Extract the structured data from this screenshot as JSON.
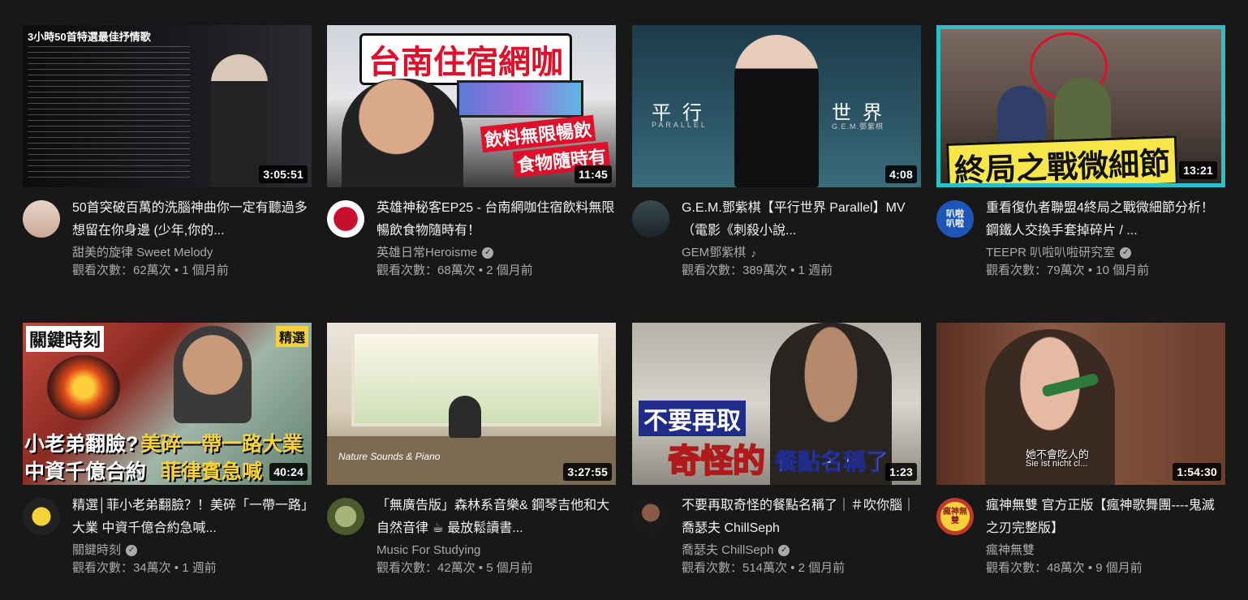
{
  "videos": [
    {
      "title": "50首突破百萬的洗腦神曲你一定有聽過多想留在你身邊 (少年,你的...",
      "channel": "甜美的旋律 Sweet Melody",
      "verified": false,
      "music_note": false,
      "views": "觀看次數：62萬次",
      "age": "1 個月前",
      "duration": "3:05:51",
      "thumb_text": "3小時50首特選最佳抒情歌"
    },
    {
      "title": "英雄神秘客EP25 - 台南網咖住宿飲料無限暢飲食物隨時有！",
      "channel": "英雄日常Heroisme",
      "verified": true,
      "music_note": false,
      "views": "觀看次數：68萬次",
      "age": "2 個月前",
      "duration": "11:45",
      "thumb_text": "台南住宿網咖",
      "thumb_text2": "飲料無限暢飲",
      "thumb_text3": "食物隨時有"
    },
    {
      "title": "G.E.M.鄧紫棋【平行世界 Parallel】MV （電影《刺殺小說...",
      "channel": "GEM鄧紫棋",
      "verified": false,
      "music_note": true,
      "views": "觀看次數：389萬次",
      "age": "1 週前",
      "duration": "4:08",
      "thumb_text": "平行",
      "thumb_text2": "世界",
      "thumb_text3": "PARALLEL",
      "thumb_text4": "G.E.M.鄧紫棋"
    },
    {
      "title": "重看復仇者聯盟4終局之戰微細節分析！鋼鐵人交換手套掉碎片 / ...",
      "channel": "TEEPR 叭啦叭啦研究室",
      "verified": true,
      "music_note": false,
      "views": "觀看次數：79萬次",
      "age": "10 個月前",
      "duration": "13:21",
      "thumb_text": "終局之戰微細節",
      "avatar_text": "叭啦叭啦"
    },
    {
      "title": "精選│菲小老弟翻臉？！美碎「一帶一路」大業 中資千億合約急喊...",
      "channel": "關鍵時刻",
      "verified": true,
      "music_note": false,
      "views": "觀看次數：34萬次",
      "age": "1 週前",
      "duration": "40:24",
      "thumb_text": "小老弟翻臉?",
      "thumb_text2": "美碎一帶一路大業",
      "thumb_text3": "中資千億合約",
      "thumb_text4": "菲律賓急喊",
      "thumb_badge": "精選",
      "thumb_logo": "關鍵時刻"
    },
    {
      "title": "「無廣告版」森林系音樂& 鋼琴吉他和大自然音律 ☕ 最放鬆讀書...",
      "channel": "Music For Studying",
      "verified": false,
      "music_note": false,
      "views": "觀看次數：42萬次",
      "age": "5 個月前",
      "duration": "3:27:55",
      "thumb_text": "Nature Sounds & Piano"
    },
    {
      "title": "不要再取奇怪的餐點名稱了｜＃吹你腦｜喬瑟夫 ChillSeph",
      "channel": "喬瑟夫 ChillSeph",
      "verified": true,
      "music_note": false,
      "views": "觀看次數：514萬次",
      "age": "2 個月前",
      "duration": "1:23",
      "thumb_text": "不要再取",
      "thumb_text2": "奇怪的",
      "thumb_text3": "餐點名稱了"
    },
    {
      "title": "瘋神無雙 官方正版【瘋神歌舞團----鬼滅之刃完整版】",
      "channel": "瘋神無雙",
      "verified": false,
      "music_note": false,
      "views": "觀看次數：48萬次",
      "age": "9 個月前",
      "duration": "1:54:30",
      "thumb_text": "她不會吃人的",
      "thumb_text2": "Sie ist nicht cl...",
      "avatar_text": "瘋神無雙"
    }
  ],
  "separator": " • ",
  "colors": {
    "background": "#181818",
    "title": "#f1f1f1",
    "secondary": "#aaaaaa"
  }
}
